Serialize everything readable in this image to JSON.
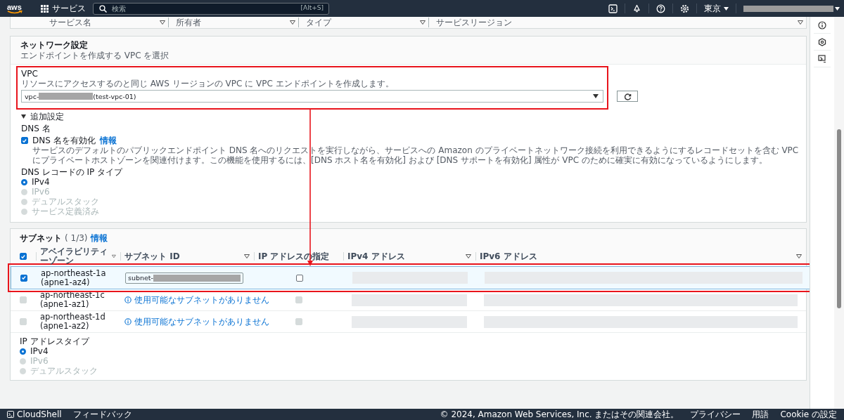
{
  "top_nav": {
    "logo_text": "aws",
    "services_label": "サービス",
    "search_placeholder": "検索",
    "search_shortcut": "[Alt+S]",
    "region": "東京"
  },
  "filter_header": {
    "columns": [
      "サービス名",
      "所有者",
      "タイプ",
      "サービスリージョン"
    ]
  },
  "network": {
    "title": "ネットワーク設定",
    "subtitle": "エンドポイントを作成する VPC を選択",
    "vpc": {
      "label": "VPC",
      "description": "リソースにアクセスするのと同じ AWS リージョンの VPC に VPC エンドポイントを作成します。",
      "value_prefix": "vpc-",
      "value_suffix": "(test-vpc-01)",
      "highlighted": true
    },
    "additional": {
      "label": "追加設定",
      "expanded": true
    },
    "dns_name": {
      "heading": "DNS 名",
      "checkbox": {
        "label": "DNS 名を有効化",
        "checked": true,
        "info": "情報",
        "description": "サービスのデフォルトのパブリックエンドポイント DNS 名へのリクエストを実行しながら、サービスへの Amazon のプライベートネットワーク接続を利用できるようにするレコードセットを含む VPC にプライベートホストゾーンを関連付けます。この機能を使用するには、[DNS ホスト名を有効化] および [DNS サポートを有効化] 属性が VPC のために確実に有効になっているようにします。"
      }
    },
    "ip_type": {
      "heading": "DNS レコードの IP タイプ",
      "options": [
        {
          "label": "IPv4",
          "selected": true,
          "disabled": false
        },
        {
          "label": "IPv6",
          "selected": false,
          "disabled": true
        },
        {
          "label": "デュアルスタック",
          "selected": false,
          "disabled": true
        },
        {
          "label": "サービス定義済み",
          "selected": false,
          "disabled": true
        }
      ]
    }
  },
  "subnets": {
    "title": "サブネット",
    "count": "( 1/3)",
    "info": "情報",
    "all_checked": true,
    "columns": [
      "アベイラビリティーゾーン",
      "サブネット ID",
      "IP アドレスの指定",
      "IPv4 アドレス",
      "IPv6 アドレス"
    ],
    "rows": [
      {
        "zone": "ap-northeast-1a (apne1-az4)",
        "checked": true,
        "disabled": false,
        "highlighted": true,
        "subnet_prefix": "subnet-",
        "ip_checked": false
      },
      {
        "zone": "ap-northeast-1c (apne1-az1)",
        "checked": false,
        "disabled": true,
        "highlighted": false,
        "message": "使用可能なサブネットがありません",
        "ip_checked": false
      },
      {
        "zone": "ap-northeast-1d (apne1-az2)",
        "checked": false,
        "disabled": true,
        "highlighted": false,
        "message": "使用可能なサブネットがありません",
        "ip_checked": false
      }
    ]
  },
  "ip_address_type": {
    "heading": "IP アドレスタイプ",
    "options": [
      {
        "label": "IPv4",
        "selected": true,
        "disabled": false
      },
      {
        "label": "IPv6",
        "selected": false,
        "disabled": true
      },
      {
        "label": "デュアルスタック",
        "selected": false,
        "disabled": true
      }
    ]
  },
  "connector_arrow": true,
  "footer": {
    "cloudshell": "CloudShell",
    "feedback": "フィードバック",
    "copyright": "© 2024, Amazon Web Services, Inc. またはその関連会社。",
    "links": [
      "プライバシー",
      "用語",
      "Cookie の設定"
    ]
  }
}
